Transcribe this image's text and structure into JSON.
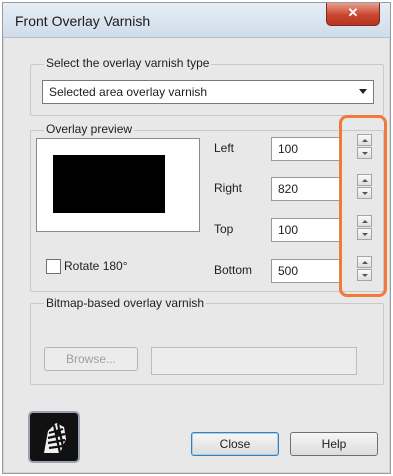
{
  "window": {
    "title": "Front Overlay Varnish",
    "close_glyph": "✕"
  },
  "varnish_type": {
    "group_label": "Select the overlay varnish type",
    "selected": "Selected area overlay varnish"
  },
  "preview": {
    "group_label": "Overlay preview"
  },
  "coords": [
    {
      "label": "Left",
      "value": "100"
    },
    {
      "label": "Right",
      "value": "820"
    },
    {
      "label": "Top",
      "value": "100"
    },
    {
      "label": "Bottom",
      "value": "500"
    }
  ],
  "rotate": {
    "label": "Rotate 180°",
    "checked": false
  },
  "bitmap": {
    "group_label": "Bitmap-based overlay varnish",
    "browse_label": "Browse...",
    "path_value": ""
  },
  "buttons": {
    "close": "Close",
    "help": "Help"
  },
  "colors": {
    "highlight": "#f07a3b",
    "close_button": "#c9452f"
  }
}
